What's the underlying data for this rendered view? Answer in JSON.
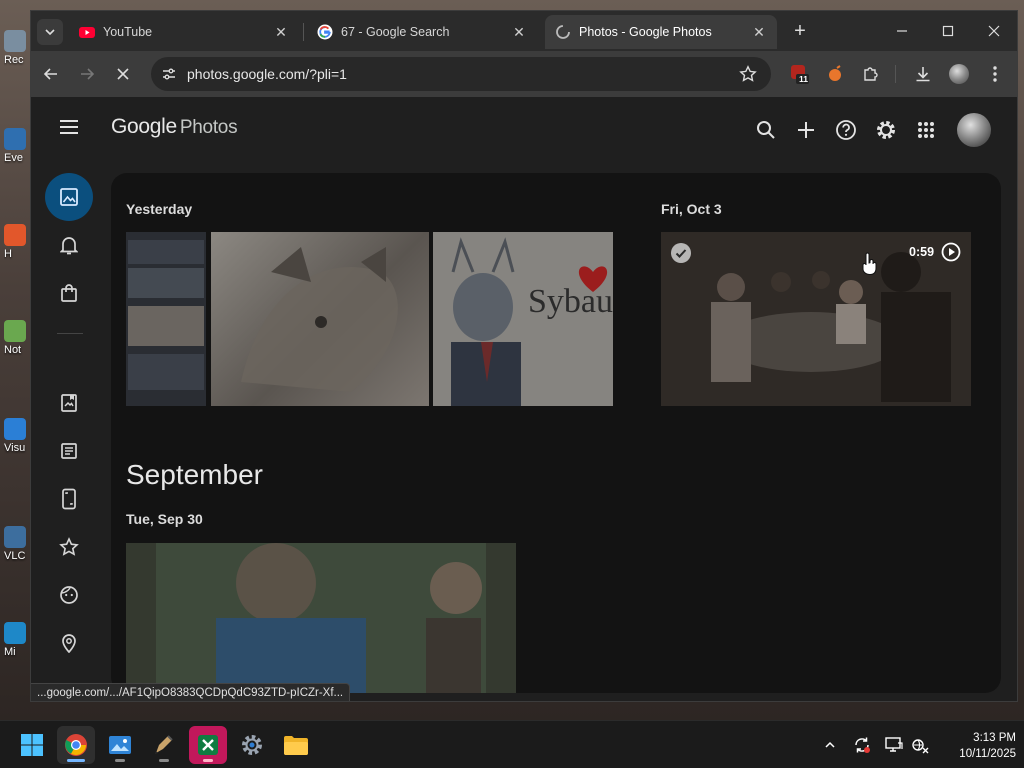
{
  "desktop": {
    "icons": [
      {
        "label": "Rec"
      },
      {
        "label": "Eve"
      },
      {
        "label": "H"
      },
      {
        "label": "Not"
      },
      {
        "label": "Visu"
      },
      {
        "label": "VLC"
      },
      {
        "label": "Mi"
      }
    ]
  },
  "browser": {
    "tabs": [
      {
        "title": "YouTube",
        "icon": "youtube-icon"
      },
      {
        "title": "67 - Google Search",
        "icon": "google-icon"
      },
      {
        "title": "Photos - Google Photos",
        "icon": "loading-icon",
        "active": true
      }
    ],
    "url": "photos.google.com/?pli=1",
    "extension_badge": "11",
    "status_url": "...google.com/.../AF1QipO8383QCDpQdC93ZTD-pICZr-Xf..."
  },
  "photos": {
    "logo_google": "Google",
    "logo_photos": "Photos",
    "header_icons": [
      "search-icon",
      "add-icon",
      "help-icon",
      "settings-icon",
      "apps-icon",
      "account-avatar"
    ],
    "rail_icons": [
      "photos-icon",
      "updates-icon",
      "shopping-icon",
      "albums-icon",
      "documents-icon",
      "screenshots-icon",
      "favorites-icon",
      "people-icon",
      "places-icon"
    ],
    "sections": [
      {
        "date": "Yesterday"
      },
      {
        "date": "Fri, Oct 3",
        "video_duration": "0:59"
      }
    ],
    "month": "September",
    "month_sections": [
      {
        "date": "Tue, Sep 30"
      }
    ]
  },
  "taskbar": {
    "apps": [
      "start-icon",
      "chrome-icon",
      "photos-app-icon",
      "paint-icon",
      "excel-icon",
      "settings-icon",
      "file-explorer-icon"
    ],
    "time": "3:13 PM",
    "date": "10/11/2025"
  },
  "colors": {
    "accent_rail_selected": "#0b4f7e",
    "app_background": "#1f1f1f",
    "content_background": "#131313"
  }
}
